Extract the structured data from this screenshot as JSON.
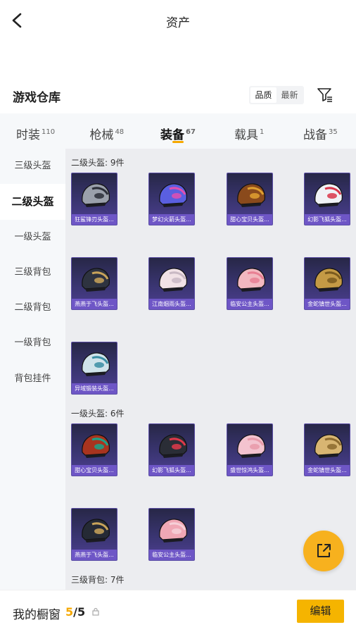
{
  "header": {
    "title": "资产"
  },
  "warehouse": {
    "title": "游戏仓库",
    "sort": [
      "品质",
      "最新"
    ],
    "sort_active": 0
  },
  "tabs": [
    {
      "label": "时装",
      "count": "110"
    },
    {
      "label": "枪械",
      "count": "48"
    },
    {
      "label": "装备",
      "count": "67"
    },
    {
      "label": "载具",
      "count": "1"
    },
    {
      "label": "战备",
      "count": "35"
    }
  ],
  "active_tab": 2,
  "sidebar": [
    {
      "label": "三级头盔"
    },
    {
      "label": "二级头盔"
    },
    {
      "label": "一级头盔"
    },
    {
      "label": "三级背包"
    },
    {
      "label": "二级背包"
    },
    {
      "label": "一级背包"
    },
    {
      "label": "背包挂件"
    }
  ],
  "active_side": 1,
  "sections": [
    {
      "title": "二级头盔: 9件",
      "items": [
        {
          "name": "狂鲨锋刃头盔...",
          "color": "#9aa0ab",
          "accent": "#2c2f38"
        },
        {
          "name": "梦幻火箭头盔...",
          "color": "#5a5fe0",
          "accent": "#e24fb0"
        },
        {
          "name": "甜心宝贝头盔...",
          "color": "#8a4a1c",
          "accent": "#e0a030"
        },
        {
          "name": "幻影飞狐头盔...",
          "color": "#f0f2f6",
          "accent": "#d9364a"
        },
        {
          "name": "燕燕于飞头盔...",
          "color": "#2e3340",
          "accent": "#c9a45a"
        },
        {
          "name": "江南烟雨头盔...",
          "color": "#f1e2e6",
          "accent": "#c9b9c4"
        },
        {
          "name": "临安公主头盔...",
          "color": "#f2b8c0",
          "accent": "#e87f93"
        },
        {
          "name": "金蛇镇世头盔...",
          "color": "#c49a45",
          "accent": "#7a5a1e"
        },
        {
          "name": "异域锻装头盔...",
          "color": "#cfe3ea",
          "accent": "#3a8ea3"
        }
      ]
    },
    {
      "title": "一级头盔: 6件",
      "items": [
        {
          "name": "甜心宝贝头盔...",
          "color": "#a8341f",
          "accent": "#1aa58a"
        },
        {
          "name": "幻影飞狐头盔...",
          "color": "#2a2d36",
          "accent": "#e0394a"
        },
        {
          "name": "盛世惊鸿头盔...",
          "color": "#f3c3cf",
          "accent": "#e89aa9"
        },
        {
          "name": "金蛇镇世头盔...",
          "color": "#d8b572",
          "accent": "#8c6a2e"
        },
        {
          "name": "燕燕于飞头盔...",
          "color": "#252a35",
          "accent": "#c9a45a"
        },
        {
          "name": "临安公主头盔...",
          "color": "#f0a7b5",
          "accent": "#f6d0d8"
        }
      ]
    },
    {
      "title": "三级背包: 7件",
      "items": [
        {
          "name": "",
          "color": "#eeeeee",
          "accent": "#333333"
        },
        {
          "name": "",
          "color": "#333333",
          "accent": "#999999"
        },
        {
          "name": "",
          "color": "#444444",
          "accent": "#888888"
        },
        {
          "name": "",
          "color": "#dddddd",
          "accent": "#666666"
        }
      ]
    }
  ],
  "showcase": {
    "label": "我的橱窗",
    "current": "5",
    "total": "/5",
    "edit": "编辑"
  }
}
